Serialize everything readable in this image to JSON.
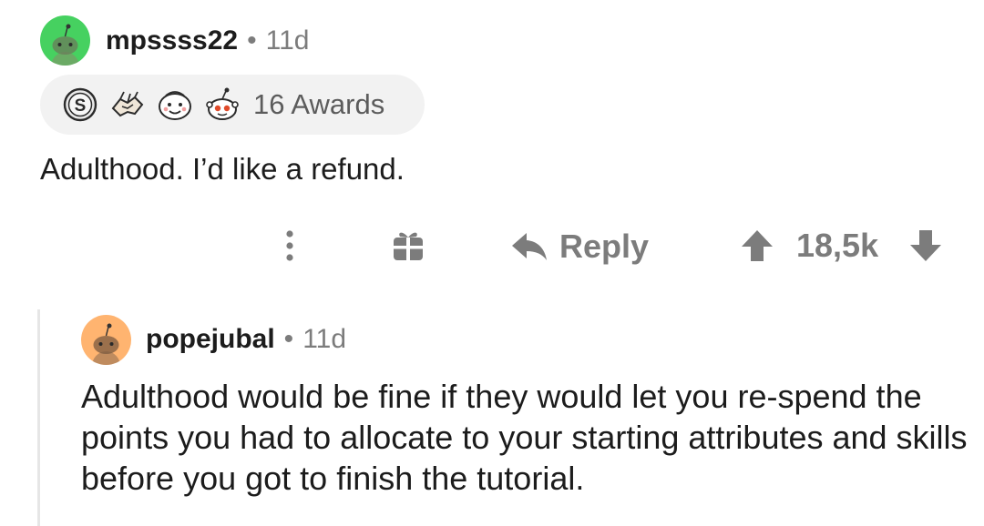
{
  "comment_1": {
    "username": "mpssss22",
    "separator": "•",
    "time": "11d",
    "awards_label": "16 Awards",
    "awards": [
      "silver-award-icon",
      "handshake-award-icon",
      "wholesome-award-icon",
      "helpful-award-icon"
    ],
    "body": "Adulthood. I’d like a refund."
  },
  "actions": {
    "reply_label": "Reply",
    "vote_count": "18,5k"
  },
  "comment_2": {
    "username": "popejubal",
    "separator": "•",
    "time": "11d",
    "body": "Adulthood would be fine if they would let you re-spend the points you had to allocate to your starting attributes and skills before you got to finish the tutorial."
  },
  "colors": {
    "avatar_1": "#46d160",
    "avatar_2": "#ffb470",
    "meta_gray": "#7c7c7c",
    "pill_bg": "#f2f2f2"
  }
}
